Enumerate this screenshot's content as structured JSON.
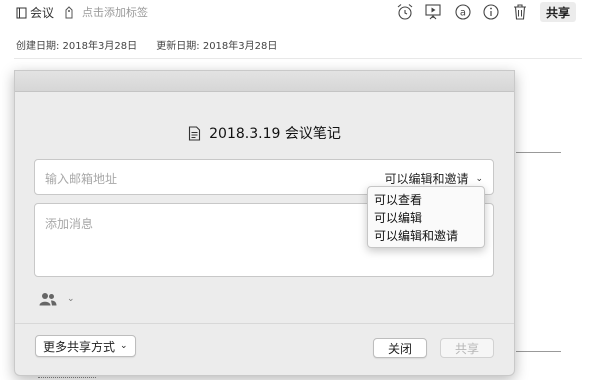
{
  "toolbar": {
    "notebook_label": "会议",
    "tag_placeholder": "点击添加标签",
    "share_label": "共享",
    "icons": [
      "alarm-icon",
      "presentation-icon",
      "at-icon",
      "info-icon",
      "trash-icon"
    ]
  },
  "dates": {
    "created": "创建日期: 2018年3月28日",
    "updated": "更新日期: 2018年3月28日"
  },
  "dialog": {
    "title": "2018.3.19 会议笔记",
    "email_placeholder": "输入邮箱地址",
    "permission_selected": "可以编辑和邀请",
    "permission_options": [
      "可以查看",
      "可以编辑",
      "可以编辑和邀请"
    ],
    "message_placeholder": "添加消息",
    "more_share_label": "更多共享方式",
    "close_label": "关闭",
    "share_label": "共享"
  },
  "colors": {
    "sheet_bg": "#ececec",
    "disabled_text": "#b7b7b7",
    "placeholder_text": "#a8a8a8"
  }
}
